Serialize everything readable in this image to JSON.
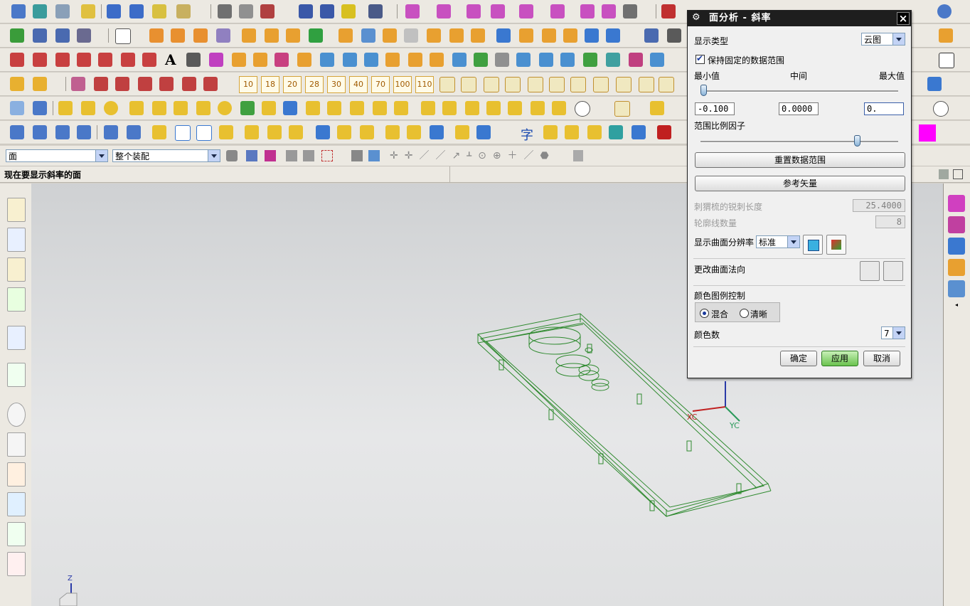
{
  "toolbar": {
    "num_buttons": [
      "10",
      "18",
      "20",
      "28",
      "30",
      "40",
      "70",
      "100",
      "110"
    ],
    "text_tool_glyph": "A",
    "char_tool": "字",
    "more": "»"
  },
  "selection_bar": {
    "filter_value": "面",
    "scope_value": "整个装配"
  },
  "cue_line": "现在要显示斜率的面",
  "dialog": {
    "title": "面分析 - 斜率",
    "close": "×",
    "display_type_label": "显示类型",
    "display_type_value": "云图",
    "keep_range_label": "保持固定的数据范围",
    "min_label": "最小值",
    "mid_label": "中间",
    "max_label": "最大值",
    "min_value": "-0.100",
    "mid_value": "0.0000",
    "max_value": "0.",
    "range_factor_label": "范围比例因子",
    "reset_range_button": "重置数据范围",
    "ref_vector_button": "参考矢量",
    "spike_length_label": "刺猬梳的锐刺长度",
    "spike_length_value": "25.4000",
    "contour_count_label": "轮廓线数量",
    "contour_count_value": "8",
    "resolution_label": "显示曲面分辨率",
    "resolution_value": "标准",
    "change_normal_label": "更改曲面法向",
    "legend_control_label": "颜色图例控制",
    "legend_blend": "混合",
    "legend_sharp": "清晰",
    "color_count_label": "颜色数",
    "color_count_value": "7",
    "ok_button": "确定",
    "apply_button": "应用",
    "cancel_button": "取消"
  },
  "viewport": {
    "wcs_x": "XC",
    "wcs_y": "YC",
    "abs_z": "Z"
  },
  "colors": {
    "model": "#2f8a2f",
    "accent": "#1a3a9c",
    "magenta": "#ff00ff"
  }
}
